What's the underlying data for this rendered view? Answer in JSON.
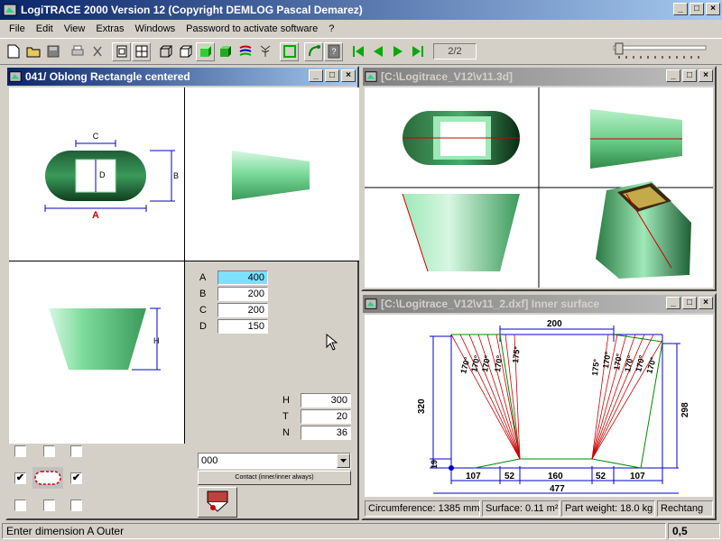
{
  "app": {
    "title": "LogiTRACE 2000  Version 12  (Copyright DEMLOG Pascal Demarez)"
  },
  "menu": [
    "File",
    "Edit",
    "View",
    "Extras",
    "Windows",
    "Password to activate software",
    "?"
  ],
  "toolbar": {
    "page_indicator": "2/2"
  },
  "left_window": {
    "title": "041/ Oblong Rectangle centered",
    "drawing_labels": {
      "a": "A",
      "b": "B",
      "c": "C",
      "d": "D",
      "h": "H"
    },
    "dims": [
      {
        "label": "A",
        "value": "400"
      },
      {
        "label": "B",
        "value": "200"
      },
      {
        "label": "C",
        "value": "200"
      },
      {
        "label": "D",
        "value": "150"
      }
    ],
    "dims2": [
      {
        "label": "H",
        "value": "300"
      },
      {
        "label": "T",
        "value": "20"
      },
      {
        "label": "N",
        "value": "36"
      }
    ],
    "combo_value": "000",
    "contact_button": "Contact (inner/inner always)"
  },
  "view3d_window": {
    "title": "[C:\\Logitrace_V12\\v11.3d]"
  },
  "dxf_window": {
    "title": "[C:\\Logitrace_V12\\v11_2.dxf]  Inner surface",
    "dims": {
      "top": "200",
      "left_h": "320",
      "right_h": "298",
      "offset": "19",
      "b1": "107",
      "b2": "52",
      "b3": "160",
      "b4": "52",
      "b5": "107",
      "total": "477"
    },
    "angles_left": [
      "170°",
      "170°",
      "170°",
      "170°",
      "175°"
    ],
    "angles_right": [
      "175°",
      "170°",
      "170°",
      "170°",
      "170°",
      "170°"
    ],
    "info": {
      "circumference": "Circumference: 1385 mm",
      "surface": "Surface: 0.11 m²",
      "weight": "Part weight: 18.0 kg",
      "shape": "Rechtang"
    }
  },
  "status": {
    "message": "Enter dimension A Outer",
    "value": "0,5"
  },
  "colors": {
    "titlebar_active": "#0a246a",
    "shape_green": "#7ddc9c",
    "dimension_blue": "#0000cc",
    "dimension_red": "#cc0000",
    "selected_field": "#7fdfff"
  }
}
